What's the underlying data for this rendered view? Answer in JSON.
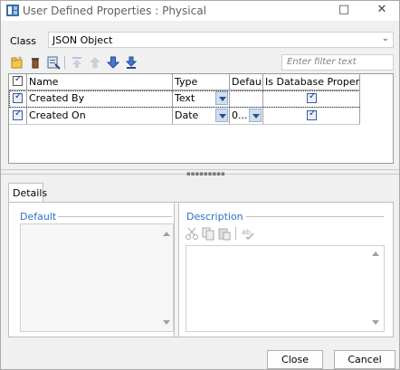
{
  "window": {
    "title": "User Defined Properties : Physical",
    "min_glyph": "—",
    "max_glyph": "□",
    "close_glyph": "✕"
  },
  "class_row": {
    "label": "Class",
    "value": "JSON Object"
  },
  "filter": {
    "placeholder": "Enter filter text"
  },
  "toolbar_icons": [
    "new-property-icon",
    "delete-icon",
    "properties-icon",
    "move-top-icon",
    "move-up-icon",
    "move-down-icon",
    "move-bottom-icon"
  ],
  "grid": {
    "headers": [
      "Name",
      "Type",
      "Default",
      "Is Database Property"
    ],
    "rows": [
      {
        "checked": true,
        "name": "Created By",
        "type": "Text",
        "default": "",
        "is_db": true
      },
      {
        "checked": true,
        "name": "Created On",
        "type": "Date",
        "default": "0...",
        "is_db": true
      }
    ]
  },
  "details": {
    "tab_label": "Details",
    "default_title": "Default",
    "description_title": "Description",
    "desc_tool_icons": [
      "cut-icon",
      "copy-icon",
      "paste-icon",
      "spell-check-icon"
    ]
  },
  "footer": {
    "close_label": "Close",
    "cancel_label": "Cancel"
  },
  "colors": {
    "section_title": "#2f6fc0",
    "selected_check": "#1a3c7a"
  }
}
